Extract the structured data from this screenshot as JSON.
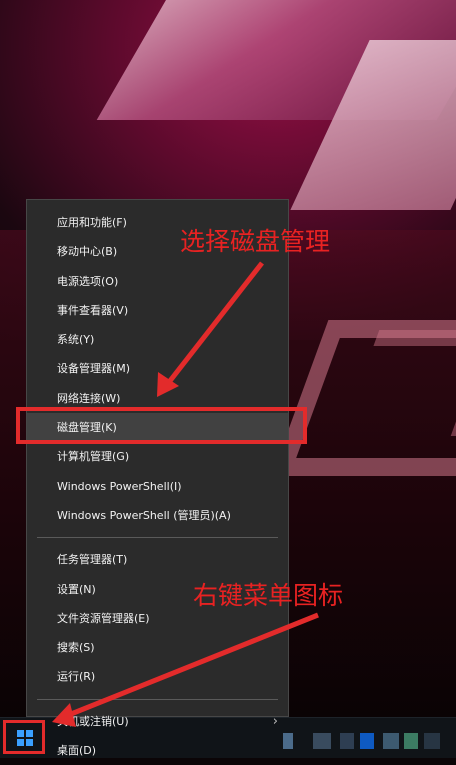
{
  "menu": {
    "items": [
      {
        "label": "应用和功能(F)"
      },
      {
        "label": "移动中心(B)"
      },
      {
        "label": "电源选项(O)"
      },
      {
        "label": "事件查看器(V)"
      },
      {
        "label": "系统(Y)"
      },
      {
        "label": "设备管理器(M)"
      },
      {
        "label": "网络连接(W)"
      },
      {
        "label": "磁盘管理(K)",
        "selected": true
      },
      {
        "label": "计算机管理(G)"
      },
      {
        "label": "Windows PowerShell(I)"
      },
      {
        "label": "Windows PowerShell (管理员)(A)"
      },
      {
        "label": "任务管理器(T)"
      },
      {
        "label": "设置(N)"
      },
      {
        "label": "文件资源管理器(E)"
      },
      {
        "label": "搜索(S)"
      },
      {
        "label": "运行(R)"
      },
      {
        "label": "关机或注销(U)",
        "submenu": true
      },
      {
        "label": "桌面(D)"
      }
    ],
    "submenu_arrow": "›"
  },
  "annotations": {
    "top": "选择磁盘管理",
    "bottom": "右键菜单图标"
  },
  "icons": {
    "start": "windows-start-icon"
  },
  "colors": {
    "annotation": "#e32b2b",
    "menu_bg": "#2b2b2b",
    "start_logo": "#3aa0ff"
  }
}
